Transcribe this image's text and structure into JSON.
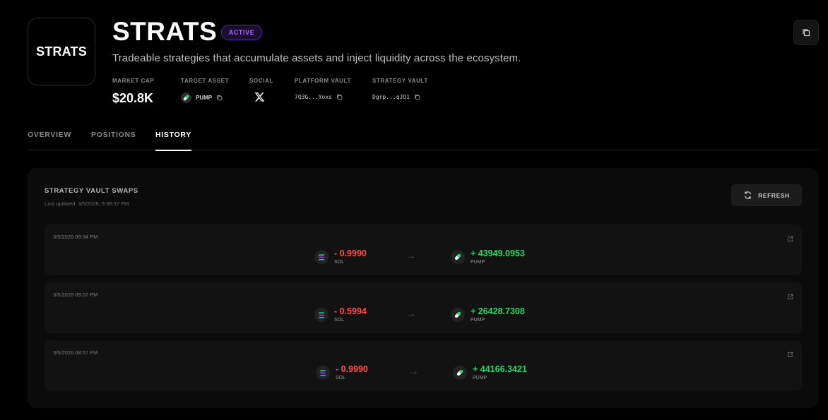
{
  "header": {
    "logo_text": "STRATS",
    "title": "STRATS",
    "status": "ACTIVE",
    "description": "Tradeable strategies that accumulate assets and inject liquidity across the ecosystem."
  },
  "stats": {
    "market_cap_label": "MARKET CAP",
    "market_cap_value": "$20.8K",
    "target_asset_label": "TARGET ASSET",
    "target_asset_value": "PUMP",
    "social_label": "SOCIAL",
    "platform_vault_label": "PLATFORM VAULT",
    "platform_vault_value": "7Q3G...Yoxs",
    "strategy_vault_label": "STRATEGY VAULT",
    "strategy_vault_value": "Dgrp...qJQ1"
  },
  "tabs": [
    {
      "label": "OVERVIEW"
    },
    {
      "label": "POSITIONS"
    },
    {
      "label": "HISTORY"
    }
  ],
  "active_tab": "HISTORY",
  "panel": {
    "title": "STRATEGY VAULT SWAPS",
    "last_updated": "Last updated: 3/5/2026, 9:38:37 PM",
    "refresh_label": "REFRESH"
  },
  "swaps": [
    {
      "time": "3/5/2026 09:34 PM",
      "from_amount": "- 0.9990",
      "from_symbol": "SOL",
      "to_amount": "+ 43949.0953",
      "to_symbol": "PUMP"
    },
    {
      "time": "3/5/2026 09:07 PM",
      "from_amount": "- 0.5994",
      "from_symbol": "SOL",
      "to_amount": "+ 26428.7308",
      "to_symbol": "PUMP"
    },
    {
      "time": "3/5/2026 08:57 PM",
      "from_amount": "- 0.9990",
      "from_symbol": "SOL",
      "to_amount": "+ 44166.3421",
      "to_symbol": "PUMP"
    }
  ],
  "colors": {
    "negative": "#ff4d4d",
    "positive": "#2ed26b",
    "badge": "#a86bff"
  },
  "icons": {
    "copy": "copy-icon",
    "x_social": "x-logo-icon",
    "pill": "pill-icon",
    "sol": "sol-icon",
    "refresh": "refresh-icon",
    "external": "external-link-icon",
    "arrow": "arrow-right-icon"
  }
}
